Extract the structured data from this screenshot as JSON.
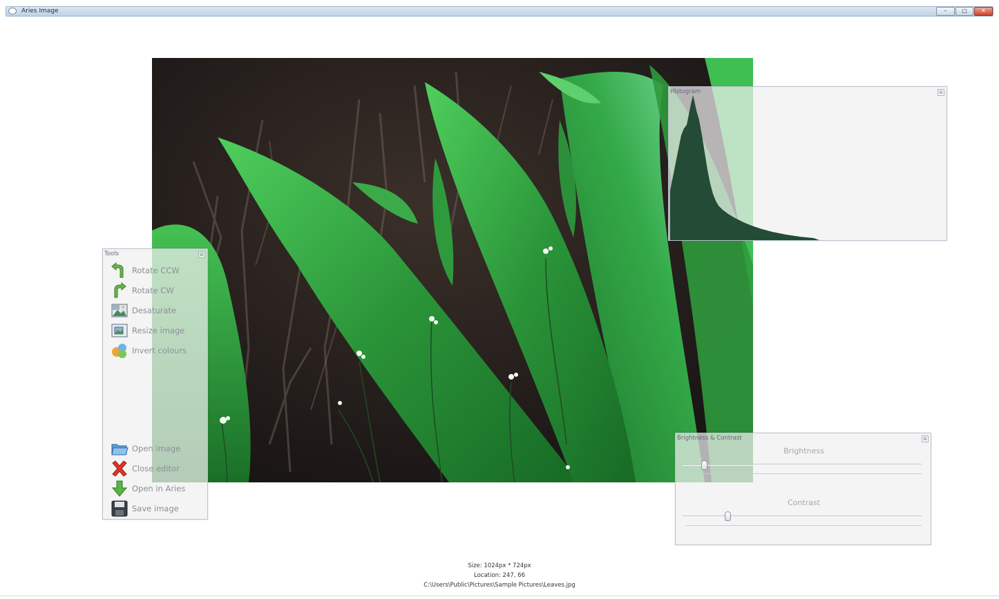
{
  "window": {
    "title": "Aries Image",
    "controls": {
      "minimize": "–",
      "maximize": "□",
      "close": "✕"
    }
  },
  "tools_panel": {
    "title": "Tools",
    "close_glyph": "⊠",
    "items": [
      {
        "label": "Rotate CCW",
        "icon": "rotate-ccw-icon"
      },
      {
        "label": "Rotate CW",
        "icon": "rotate-cw-icon"
      },
      {
        "label": "Desaturate",
        "icon": "desaturate-icon"
      },
      {
        "label": "Resize image",
        "icon": "resize-image-icon"
      },
      {
        "label": "Invert colours",
        "icon": "invert-colours-icon"
      }
    ],
    "file_items": [
      {
        "label": "Open image",
        "icon": "folder-icon"
      },
      {
        "label": "Close editor",
        "icon": "close-x-icon"
      },
      {
        "label": "Open in Aries",
        "icon": "down-arrow-icon"
      },
      {
        "label": "Save image",
        "icon": "floppy-disk-icon"
      }
    ]
  },
  "histogram_panel": {
    "title": "Histogram",
    "close_glyph": "⊠"
  },
  "brightness_contrast_panel": {
    "title": "Brightness & Contrast",
    "close_glyph": "⊠",
    "brightness": {
      "label": "Brightness",
      "value": 0.08
    },
    "contrast": {
      "label": "Contrast",
      "value": 0.18
    }
  },
  "status": {
    "size": "Size: 1024px * 724px",
    "location": "Location: 247, 66",
    "path": "C:\\Users\\Public\\Pictures\\Sample Pictures\\Leaves.jpg"
  },
  "colors": {
    "leaf_green": "#2f9a3c",
    "leaf_light": "#5cc46a",
    "background_dark": "#2a2422",
    "histogram_fill": "#244b35"
  }
}
